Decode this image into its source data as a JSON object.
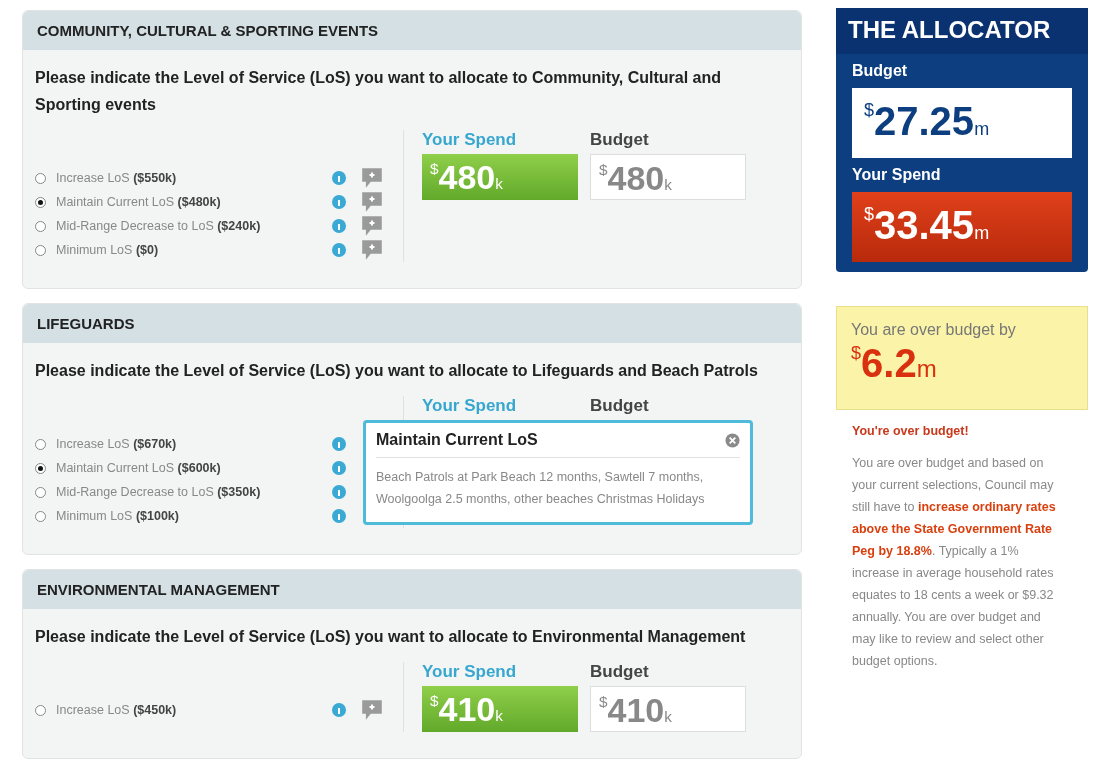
{
  "sections": [
    {
      "title": "COMMUNITY, CULTURAL & SPORTING EVENTS",
      "question": "Please indicate the Level of Service (LoS) you want to allocate to Community, Cultural and Sporting events",
      "comment_icons": true,
      "options": [
        {
          "label": "Increase LoS **($550k)**",
          "selected": false
        },
        {
          "label": "Maintain Current LoS **($480k)**",
          "selected": true
        },
        {
          "label": "Mid-Range Decrease to LoS **($240k)**",
          "selected": false
        },
        {
          "label": "Minimum LoS **($0)**",
          "selected": false
        }
      ],
      "spend_label": "Your Spend",
      "budget_label": "Budget",
      "spend": {
        "currency": "$",
        "amount": "480",
        "unit": "k"
      },
      "budget": {
        "currency": "$",
        "amount": "480",
        "unit": "k"
      }
    },
    {
      "title": "LIFEGUARDS",
      "question": "Please indicate the Level of Service (LoS) you want to allocate to Lifeguards and Beach Patrols",
      "comment_icons": false,
      "options": [
        {
          "label": "Increase LoS **($670k)**",
          "selected": false
        },
        {
          "label": "Maintain Current LoS **($600k)**",
          "selected": true
        },
        {
          "label": "Mid-Range Decrease to LoS **($350k)**",
          "selected": false
        },
        {
          "label": "Minimum LoS **($100k)**",
          "selected": false
        }
      ],
      "spend_label": "Your Spend",
      "budget_label": "Budget",
      "tooltip": {
        "title": "Maintain Current LoS",
        "body": "Beach Patrols at Park Beach 12 months, Sawtell 7 months, Woolgoolga 2.5 months, other beaches Christmas Holidays"
      }
    },
    {
      "title": "ENVIRONMENTAL MANAGEMENT",
      "question": "Please indicate the Level of Service (LoS) you want to allocate to Environmental Management",
      "comment_icons": true,
      "options": [
        {
          "label": "Increase LoS **($450k)**",
          "selected": false
        }
      ],
      "spend_label": "Your Spend",
      "budget_label": "Budget",
      "spend": {
        "currency": "$",
        "amount": "410",
        "unit": "k"
      },
      "budget": {
        "currency": "$",
        "amount": "410",
        "unit": "k"
      }
    }
  ],
  "allocator": {
    "title": "THE ALLOCATOR",
    "budget_label": "Budget",
    "budget": {
      "currency": "$",
      "amount": "27.25",
      "unit": "m"
    },
    "spend_label": "Your Spend",
    "spend": {
      "currency": "$",
      "amount": "33.45",
      "unit": "m"
    }
  },
  "over_budget": {
    "label": "You are over budget by",
    "amount": {
      "currency": "$",
      "amount": "6.2",
      "unit": "m"
    }
  },
  "warning": {
    "title": "You're over budget!",
    "body": "You are over budget and based on your current selections, Council may still have to **increase ordinary rates above the State Government Rate Peg by 18.8%**. Typically a 1% increase in average household rates equates to 18 cents a week or $9.32 annually. You are over budget and may like to review and select other budget options."
  }
}
